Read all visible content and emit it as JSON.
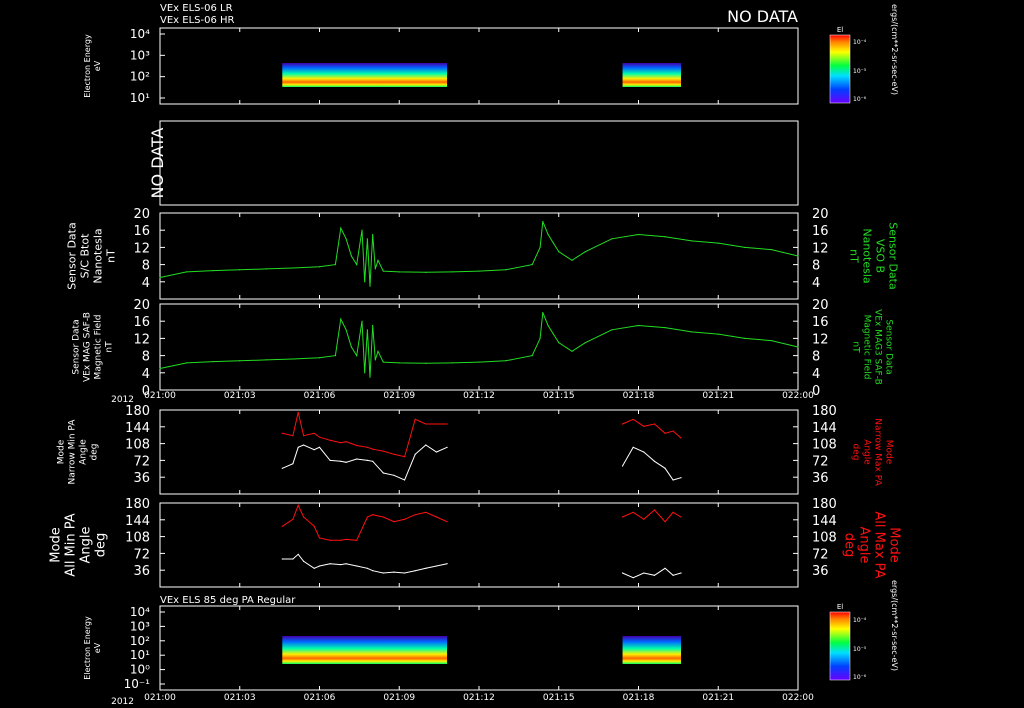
{
  "header": {
    "line1": "VEx ELS-06 LR",
    "line2": "VEx ELS-06 HR",
    "nodata": "NO DATA"
  },
  "colorbar": {
    "label": "El",
    "units": "ergs/(cm**2-sr-sec-eV)",
    "ticks": [
      "10⁻⁴",
      "10⁻⁵",
      "10⁻⁶"
    ]
  },
  "panel2": {
    "nodata": "NO DATA"
  },
  "panel7": {
    "title": "VEx ELS 85 deg PA Regular"
  },
  "axis": {
    "year": "2012",
    "ticks": [
      "021:00",
      "021:03",
      "021:06",
      "021:09",
      "021:12",
      "021:15",
      "021:18",
      "021:21",
      "022:00"
    ]
  },
  "labels": {
    "p1": [
      "Electron Energy",
      "eV"
    ],
    "p3_left": [
      "Sensor Data",
      "S/C Btot",
      "Nanotesla",
      "nT"
    ],
    "p3_right": [
      "Sensor Data",
      "VSO B",
      "Nanotesla",
      "nT"
    ],
    "p4_left": [
      "Sensor Data",
      "VEx MAG SAF-B",
      "Magnetic Field",
      "nT"
    ],
    "p4_right": [
      "Sensor Data",
      "VEx MAG3 SAF-B",
      "Magnetic Field",
      "nT"
    ],
    "p5_left": [
      "Mode",
      "Narrow Min PA",
      "Angle",
      "deg"
    ],
    "p5_right": [
      "Mode",
      "Narrow Max PA",
      "Angle",
      "deg"
    ],
    "p6_left": [
      "Mode",
      "All Min PA",
      "Angle",
      "deg"
    ],
    "p6_right": [
      "Mode",
      "All Max PA",
      "Angle",
      "deg"
    ],
    "p7": [
      "Electron Energy",
      "eV"
    ]
  },
  "colors": {
    "green": "#22dd22",
    "red": "#ff1111",
    "white": "#ffffff",
    "frame": "#ffffff"
  },
  "chart_data": [
    {
      "type": "heatmap",
      "panel": "p1",
      "ylabel": "Electron Energy eV",
      "yticks": [
        "10⁴",
        "10³",
        "10²",
        "10¹"
      ],
      "data_intervals": [
        [
          "021:04.6",
          "021:10.8"
        ],
        [
          "021:17.4",
          "021:19.6"
        ]
      ],
      "xlim": [
        "021:00",
        "022:00"
      ]
    },
    {
      "type": "line",
      "panel": "p3",
      "ylabel": "Sensor Data S/C Btot Nanotesla nT",
      "y2label": "Sensor Data VSO B Nanotesla nT",
      "ylim": [
        0,
        20
      ],
      "yticks": [
        4,
        8,
        12,
        16,
        20
      ],
      "x_minutes": [
        0,
        1,
        2,
        3,
        4,
        5,
        6,
        6.6,
        6.8,
        7,
        7.2,
        7.4,
        7.6,
        7.7,
        7.8,
        7.9,
        8,
        8.1,
        8.2,
        8.4,
        9,
        10,
        11,
        12,
        13,
        14,
        14.3,
        14.4,
        14.6,
        14.8,
        15,
        15.5,
        16,
        17,
        18,
        19,
        20,
        21,
        22,
        23,
        24
      ],
      "series": [
        {
          "values": [
            5,
            6.3,
            6.6,
            6.8,
            7,
            7.2,
            7.5,
            8,
            16.5,
            14,
            10,
            8,
            16,
            4,
            14,
            3,
            15,
            7,
            9,
            6.5,
            6.3,
            6.2,
            6.3,
            6.5,
            6.8,
            8,
            12,
            18,
            15,
            13,
            11,
            9,
            11,
            14,
            15,
            14.5,
            13.5,
            13,
            12,
            11.5,
            10
          ]
        }
      ]
    },
    {
      "type": "line",
      "panel": "p4",
      "ylabel": "Sensor Data VEx MAG SAF-B Magnetic Field nT",
      "y2label": "Sensor Data VEx MAG3 SAF-B Magnetic Field nT",
      "ylim": [
        0,
        20
      ],
      "yticks": [
        0,
        4,
        8,
        12,
        16,
        20
      ],
      "x_minutes": [
        0,
        1,
        2,
        3,
        4,
        5,
        6,
        6.6,
        6.8,
        7,
        7.2,
        7.4,
        7.6,
        7.7,
        7.8,
        7.9,
        8,
        8.1,
        8.2,
        8.4,
        9,
        10,
        11,
        12,
        13,
        14,
        14.3,
        14.4,
        14.6,
        14.8,
        15,
        15.5,
        16,
        17,
        18,
        19,
        20,
        21,
        22,
        23,
        24
      ],
      "series": [
        {
          "values": [
            5,
            6.3,
            6.6,
            6.8,
            7,
            7.2,
            7.5,
            8,
            16.5,
            14,
            10,
            8,
            16,
            4,
            14,
            3,
            15,
            7,
            9,
            6.5,
            6.3,
            6.2,
            6.3,
            6.5,
            6.8,
            8,
            12,
            18,
            15,
            13,
            11,
            9,
            11,
            14,
            15,
            14.5,
            13.5,
            13,
            12,
            11.5,
            10
          ]
        }
      ]
    },
    {
      "type": "line",
      "panel": "p5",
      "ylabel": "Mode Narrow Min PA Angle deg",
      "y2label": "Mode Narrow Max PA Angle deg",
      "ylim": [
        0,
        180
      ],
      "yticks": [
        36,
        72,
        108,
        144,
        180
      ],
      "segments": [
        [
          "021:04.6",
          "021:10.8"
        ],
        [
          "021:17.4",
          "021:19.6"
        ]
      ],
      "series": [
        {
          "color": "red",
          "x_minutes": [
            4.6,
            5,
            5.2,
            5.4,
            5.8,
            6,
            6.4,
            6.8,
            7,
            7.4,
            7.8,
            8,
            8.4,
            8.8,
            9.2,
            9.6,
            10,
            10.4,
            10.8
          ],
          "values": [
            130,
            125,
            175,
            125,
            130,
            122,
            115,
            110,
            112,
            104,
            100,
            96,
            92,
            85,
            80,
            160,
            150,
            150,
            150
          ]
        },
        {
          "color": "white",
          "x_minutes": [
            4.6,
            5,
            5.2,
            5.4,
            5.8,
            6,
            6.4,
            6.8,
            7,
            7.4,
            7.8,
            8,
            8.4,
            8.8,
            9.2,
            9.6,
            10,
            10.4,
            10.8
          ],
          "values": [
            55,
            65,
            100,
            105,
            95,
            100,
            72,
            70,
            68,
            75,
            72,
            70,
            45,
            40,
            30,
            85,
            105,
            90,
            100
          ]
        },
        {
          "color": "red",
          "x_minutes": [
            17.4,
            17.8,
            18.2,
            18.6,
            19,
            19.3,
            19.6
          ],
          "values": [
            150,
            160,
            145,
            150,
            130,
            135,
            120
          ]
        },
        {
          "color": "white",
          "x_minutes": [
            17.4,
            17.8,
            18.2,
            18.6,
            19,
            19.3,
            19.6
          ],
          "values": [
            60,
            100,
            90,
            70,
            55,
            30,
            35
          ]
        }
      ]
    },
    {
      "type": "line",
      "panel": "p6",
      "ylabel": "Mode All Min PA Angle deg",
      "y2label": "Mode All Max PA Angle deg",
      "ylim": [
        0,
        180
      ],
      "yticks": [
        36,
        72,
        108,
        144,
        180
      ],
      "series": [
        {
          "color": "red",
          "x_minutes": [
            4.6,
            5,
            5.2,
            5.4,
            5.8,
            6,
            6.4,
            6.8,
            7,
            7.4,
            7.8,
            8,
            8.4,
            8.8,
            9.2,
            9.6,
            10,
            10.4,
            10.8
          ],
          "values": [
            130,
            145,
            175,
            150,
            130,
            105,
            100,
            100,
            102,
            100,
            150,
            155,
            150,
            140,
            145,
            155,
            160,
            150,
            140
          ]
        },
        {
          "color": "white",
          "x_minutes": [
            4.6,
            5,
            5.2,
            5.4,
            5.8,
            6,
            6.4,
            6.8,
            7,
            7.4,
            7.8,
            8,
            8.4,
            8.8,
            9.2,
            9.6,
            10,
            10.4,
            10.8
          ],
          "values": [
            60,
            60,
            70,
            55,
            40,
            45,
            50,
            48,
            50,
            45,
            40,
            35,
            30,
            32,
            30,
            35,
            40,
            45,
            50
          ]
        },
        {
          "color": "red",
          "x_minutes": [
            17.4,
            17.8,
            18.2,
            18.6,
            19,
            19.3,
            19.6
          ],
          "values": [
            150,
            160,
            145,
            165,
            140,
            160,
            150
          ]
        },
        {
          "color": "white",
          "x_minutes": [
            17.4,
            17.8,
            18.2,
            18.6,
            19,
            19.3,
            19.6
          ],
          "values": [
            30,
            20,
            30,
            25,
            40,
            25,
            30
          ]
        }
      ]
    },
    {
      "type": "heatmap",
      "panel": "p7",
      "title": "VEx ELS 85 deg PA Regular",
      "ylabel": "Electron Energy eV",
      "yticks": [
        "10⁴",
        "10³",
        "10²",
        "10¹",
        "10⁰",
        "10⁻¹"
      ],
      "data_intervals": [
        [
          "021:04.6",
          "021:10.8"
        ],
        [
          "021:17.4",
          "021:19.6"
        ]
      ],
      "xlim": [
        "021:00",
        "022:00"
      ]
    }
  ]
}
